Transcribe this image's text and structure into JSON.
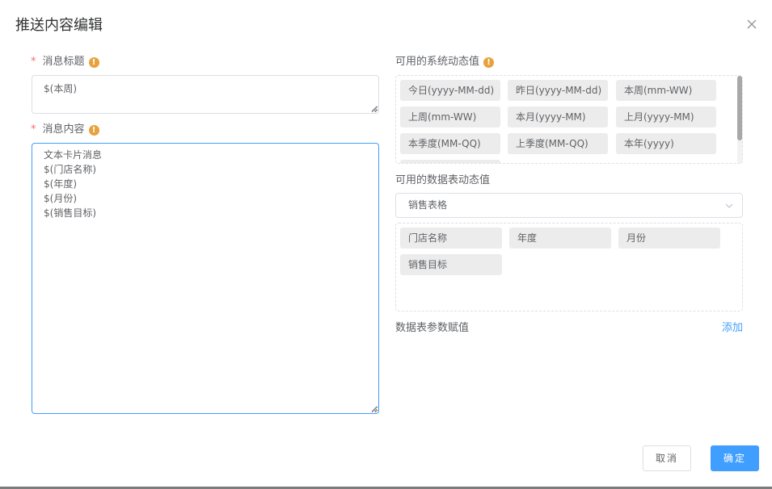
{
  "dialog": {
    "title": "推送内容编辑",
    "close_icon": "close-icon"
  },
  "form": {
    "message_title_label": "消息标题",
    "message_title_value": "$(本周)",
    "message_content_label": "消息内容",
    "message_content_value": "文本卡片消息\n$(门店名称)\n$(年度)\n$(月份)\n$(销售目标)",
    "required_mark": "*",
    "info_mark": "!"
  },
  "system_values": {
    "label": "可用的系统动态值",
    "items": [
      "今日(yyyy-MM-dd)",
      "昨日(yyyy-MM-dd)",
      "本周(mm-WW)",
      "上周(mm-WW)",
      "本月(yyyy-MM)",
      "上月(yyyy-MM)",
      "本季度(MM-QQ)",
      "上季度(MM-QQ)",
      "本年(yyyy)"
    ]
  },
  "table_values": {
    "label": "可用的数据表动态值",
    "selected_table": "销售表格",
    "items": [
      "门店名称",
      "年度",
      "月份",
      "销售目标"
    ]
  },
  "param_assign": {
    "label": "数据表参数赋值",
    "add_label": "添加"
  },
  "footer": {
    "cancel_label": "取消",
    "confirm_label": "确定"
  },
  "colors": {
    "primary": "#409eff",
    "warning": "#e6a23c",
    "danger": "#f56c6c",
    "chip_bg": "#ececec"
  }
}
